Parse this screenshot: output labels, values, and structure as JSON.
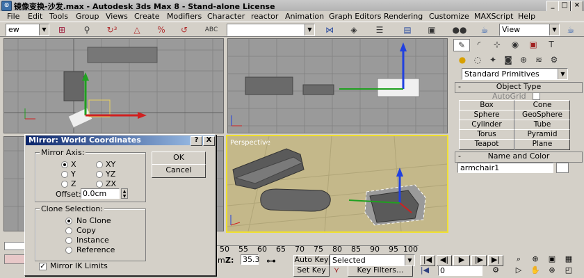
{
  "window": {
    "title": "镜像变换-沙发.max - Autodesk 3ds Max 8 - Stand-alone License",
    "app_icon": "3ds-max-icon",
    "controls": [
      "minimize-icon",
      "maximize-icon",
      "close-icon"
    ]
  },
  "menu": [
    "File",
    "Edit",
    "Tools",
    "Group",
    "Views",
    "Create",
    "Modifiers",
    "Character",
    "reactor",
    "Animation",
    "Graph Editors",
    "Rendering",
    "Customize",
    "MAXScript",
    "Help"
  ],
  "toolbar": {
    "selection_filter": "ew",
    "named_selection": "",
    "view_dropdown": "View"
  },
  "viewports": {
    "perspective_label": "Perspective"
  },
  "command_panel": {
    "primitives_dropdown": "Standard Primitives",
    "object_type_header": "Object Type",
    "autogrid_label": "AutoGrid",
    "buttons": [
      "Box",
      "Cone",
      "Sphere",
      "GeoSphere",
      "Cylinder",
      "Tube",
      "Torus",
      "Pyramid",
      "Teapot",
      "Plane"
    ],
    "name_color_header": "Name and Color",
    "object_name": "armchair1"
  },
  "dialog": {
    "title": "Mirror: World Coordinates",
    "help_btn": "?",
    "close_btn": "X",
    "mirror_axis_label": "Mirror Axis:",
    "axes": [
      {
        "label": "X",
        "checked": true
      },
      {
        "label": "XY",
        "checked": false
      },
      {
        "label": "Y",
        "checked": false
      },
      {
        "label": "YZ",
        "checked": false
      },
      {
        "label": "Z",
        "checked": false
      },
      {
        "label": "ZX",
        "checked": false
      }
    ],
    "offset_label": "Offset:",
    "offset_value": "0.0cm",
    "ok_label": "OK",
    "cancel_label": "Cancel",
    "clone_selection_label": "Clone Selection:",
    "clone_options": [
      {
        "label": "No Clone",
        "checked": true
      },
      {
        "label": "Copy",
        "checked": false
      },
      {
        "label": "Instance",
        "checked": false
      },
      {
        "label": "Reference",
        "checked": false
      }
    ],
    "mirror_ik_label": "Mirror IK Limits",
    "mirror_ik_checked": true
  },
  "timeline": {
    "ticks": [
      "50",
      "55",
      "60",
      "65",
      "70",
      "75",
      "80",
      "85",
      "90",
      "95",
      "100"
    ]
  },
  "status": {
    "coord_value": "35.3",
    "coord_prefix": "m",
    "z_label": "Z:",
    "auto_key": "Auto Key",
    "set_key": "Set Key",
    "selected_dropdown": "Selected",
    "key_filters": "Key Filters...",
    "frame_value": "0"
  }
}
